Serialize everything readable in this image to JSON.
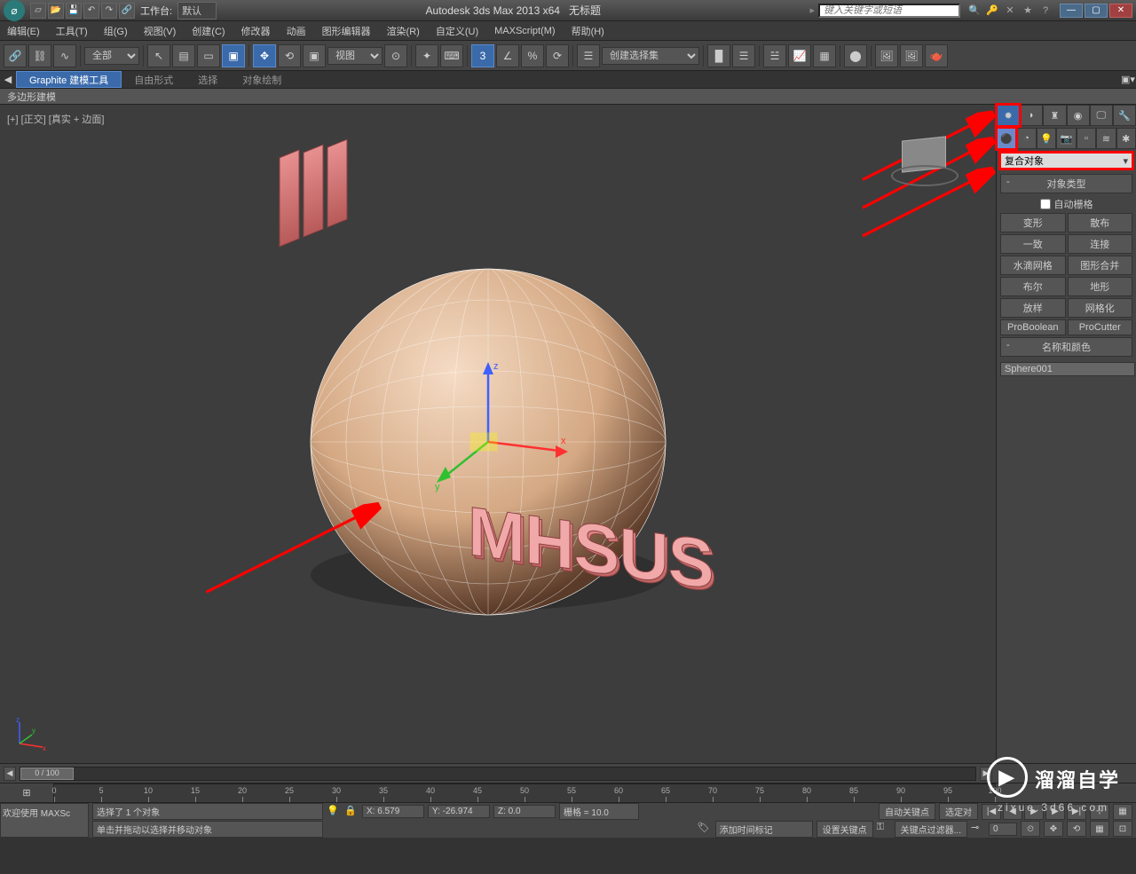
{
  "title": {
    "app": "Autodesk 3ds Max  2013 x64",
    "doc": "无标题",
    "workspace_label": "工作台:",
    "workspace_value": "默认",
    "search_placeholder": "键入关键字或短语"
  },
  "menu": [
    "编辑(E)",
    "工具(T)",
    "组(G)",
    "视图(V)",
    "创建(C)",
    "修改器",
    "动画",
    "图形编辑器",
    "渲染(R)",
    "自定义(U)",
    "MAXScript(M)",
    "帮助(H)"
  ],
  "toolbar": {
    "filter_combo": "全部",
    "view_combo": "视图",
    "selection_set": "创建选择集"
  },
  "ribbon": {
    "tabs": [
      "Graphite 建模工具",
      "自由形式",
      "选择",
      "对象绘制"
    ],
    "sub": "多边形建模"
  },
  "viewport": {
    "label": "[+] [正交] [真实 + 边面]",
    "scene_text": "MHSUS"
  },
  "command_panel": {
    "category": "复合对象",
    "rollout_type": "对象类型",
    "auto_grid": "自动栅格",
    "buttons": [
      [
        "变形",
        "散布"
      ],
      [
        "一致",
        "连接"
      ],
      [
        "水滴网格",
        "图形合并"
      ],
      [
        "布尔",
        "地形"
      ],
      [
        "放样",
        "网格化"
      ],
      [
        "ProBoolean",
        "ProCutter"
      ]
    ],
    "rollout_name": "名称和颜色",
    "object_name": "Sphere001"
  },
  "timeline": {
    "slider": "0 / 100",
    "ticks": [
      0,
      5,
      10,
      15,
      20,
      25,
      30,
      35,
      40,
      45,
      50,
      55,
      60,
      65,
      70,
      75,
      80,
      85,
      90,
      95,
      100
    ]
  },
  "status": {
    "left": "欢迎使用  MAXSc",
    "sel_msg": "选择了 1 个对象",
    "hint": "单击并拖动以选择并移动对象",
    "x": "X: 6.579",
    "y": "Y: -26.974",
    "z": "Z: 0.0",
    "grid": "栅格 = 10.0",
    "add_tag": "添加时间标记",
    "autokey": "自动关键点",
    "setkey": "设置关键点",
    "selected": "选定对",
    "keyfilter": "关键点过滤器...",
    "frame": "0"
  },
  "watermark": {
    "brand": "溜溜自学",
    "url": "zixue.3d66.com"
  }
}
